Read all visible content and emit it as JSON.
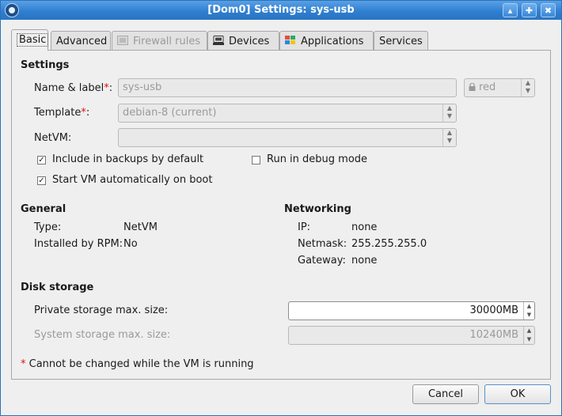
{
  "window": {
    "title": "[Dom0] Settings: sys-usb"
  },
  "tabs": [
    {
      "label": "Basic",
      "active": true
    },
    {
      "label": "Advanced"
    },
    {
      "label": "Firewall rules",
      "disabled": true,
      "icon": "firewall-icon"
    },
    {
      "label": "Devices",
      "icon": "devices-icon"
    },
    {
      "label": "Applications",
      "icon": "applications-icon"
    },
    {
      "label": "Services"
    }
  ],
  "settings": {
    "heading": "Settings",
    "name_label": "Name & label",
    "name_value": "sys-usb",
    "label_color": "red",
    "template_label": "Template",
    "template_value": "debian-8 (current)",
    "netvm_label": "NetVM:",
    "netvm_value": "",
    "required_mark": "*",
    "colon": ":",
    "include_backups": {
      "label": "Include in backups by default",
      "checked": true
    },
    "debug_mode": {
      "label": "Run in debug mode",
      "checked": false
    },
    "autostart": {
      "label": "Start VM automatically on boot",
      "checked": true
    }
  },
  "general": {
    "heading": "General",
    "type_label": "Type:",
    "type_value": "NetVM",
    "rpm_label": "Installed by RPM:",
    "rpm_value": "No"
  },
  "networking": {
    "heading": "Networking",
    "ip_label": "IP:",
    "ip_value": "none",
    "netmask_label": "Netmask:",
    "netmask_value": "255.255.255.0",
    "gateway_label": "Gateway:",
    "gateway_value": "none"
  },
  "disk": {
    "heading": "Disk storage",
    "private_label": "Private storage max. size:",
    "private_value": "30000MB",
    "system_label": "System storage max. size:",
    "system_value": "10240MB"
  },
  "footnote": {
    "mark": "*",
    "text": " Cannot be changed while the VM is running"
  },
  "buttons": {
    "cancel": "Cancel",
    "ok": "OK"
  },
  "colors": {
    "titlebar": "#2f7fd1",
    "required": "#dd1111",
    "label_red": "#aa2222"
  }
}
